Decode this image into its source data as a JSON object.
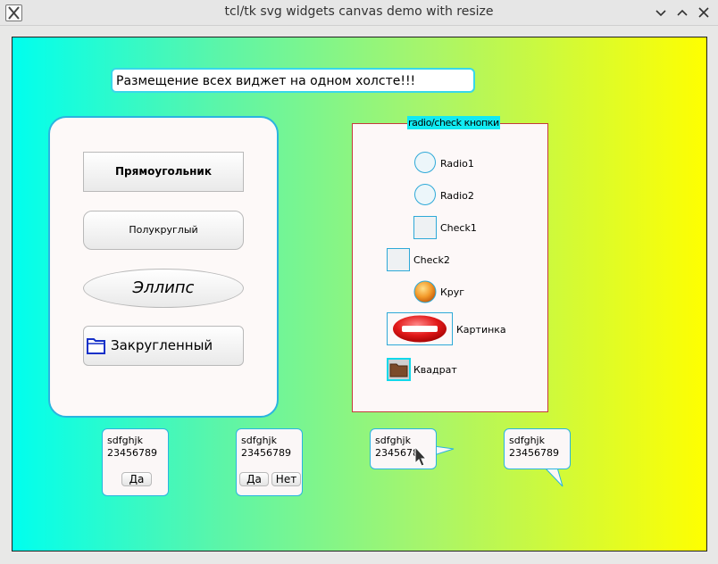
{
  "window": {
    "title": "tcl/tk svg widgets canvas demo with resize"
  },
  "entry": {
    "value": "Размещение всех виджет на одном холсте!!!"
  },
  "left_panel": {
    "btn_rect": "Прямоугольник",
    "btn_semiround": "Полукруглый",
    "btn_ellipse": "Эллипс",
    "btn_rounded": "Закругленный"
  },
  "right_panel": {
    "legend": "radio/check кнопки",
    "radio1": "Radio1",
    "radio2": "Radio2",
    "check1": "Check1",
    "check2": "Check2",
    "circle": "Круг",
    "picture": "Картинка",
    "square": "Квадрат"
  },
  "bubbles": [
    {
      "line1": "sdfghjk",
      "line2": "23456789",
      "yes": "Да"
    },
    {
      "line1": "sdfghjk",
      "line2": "23456789",
      "yes": "Да",
      "no": "Нет"
    },
    {
      "line1": "sdfghjk",
      "line2": "2345678"
    },
    {
      "line1": "sdfghjk",
      "line2": "23456789"
    }
  ],
  "colors": {
    "accent": "#2ab4e0",
    "frame_border": "#c43b3b",
    "legend_bg": "#11eaf2"
  }
}
